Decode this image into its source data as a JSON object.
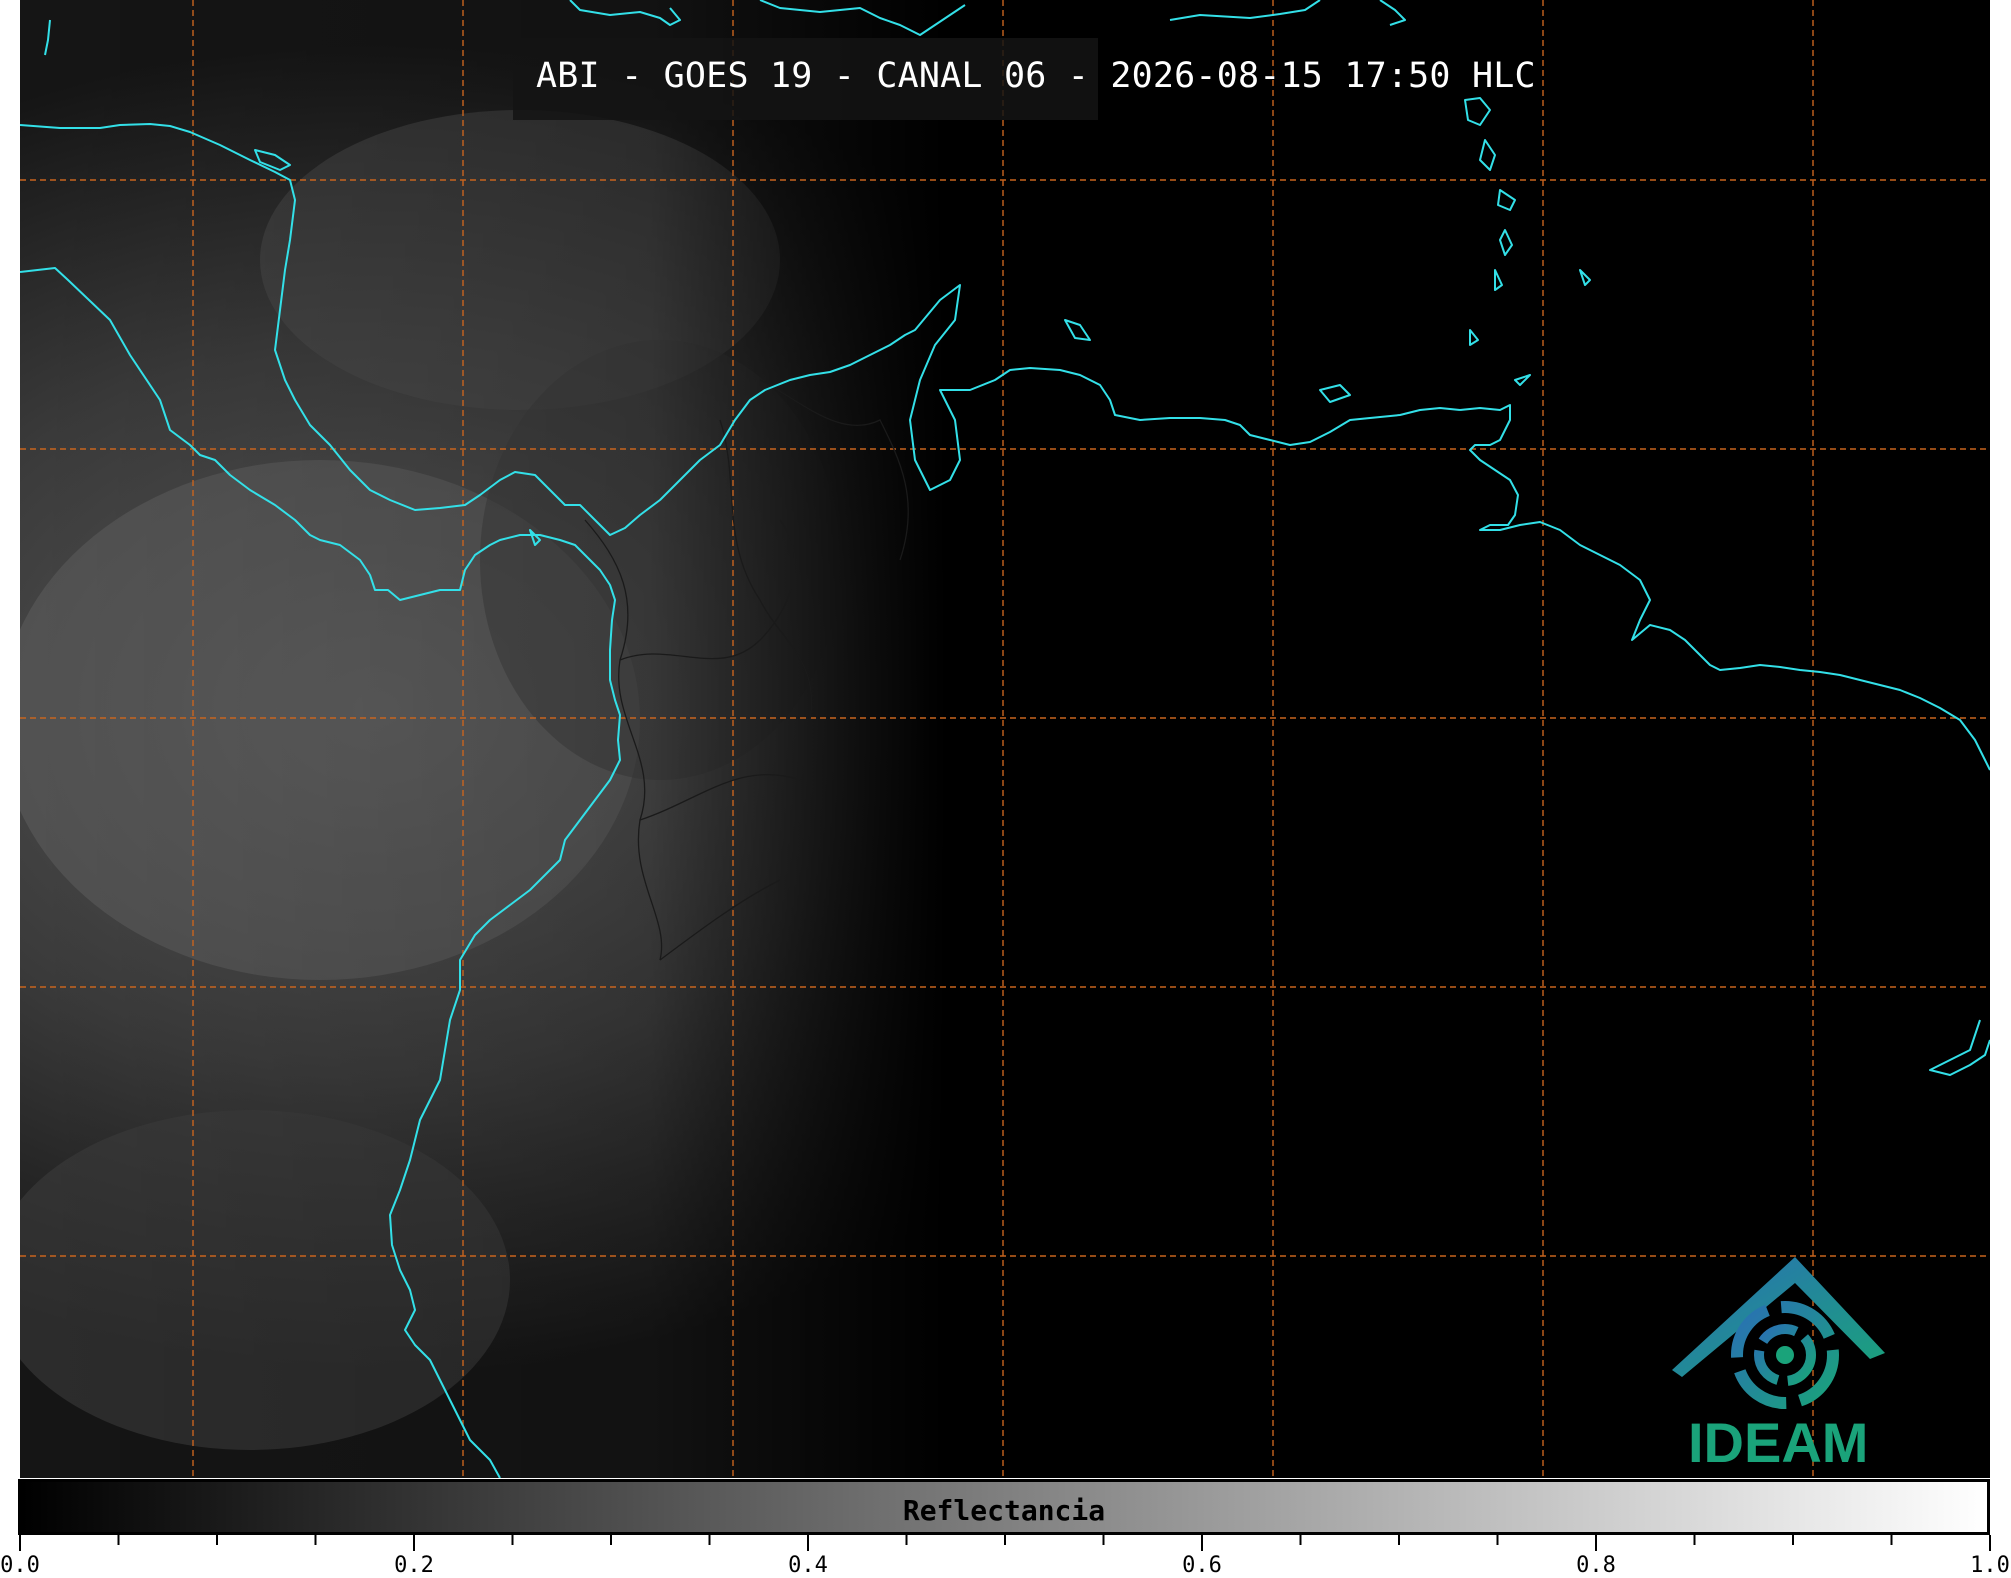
{
  "title": "ABI - GOES 19 - CANAL 06 - 2026-08-15 17:50 HLC",
  "colorbar": {
    "label": "Reflectancia",
    "min": 0.0,
    "max": 1.0,
    "tick_labels": [
      "0.0",
      "0.2",
      "0.4",
      "0.6",
      "0.8",
      "1.0"
    ],
    "colormap": "grayscale"
  },
  "logo": {
    "text": "IDEAM",
    "color_blue": "#2a6fb5",
    "color_green": "#1aa37a"
  },
  "colors": {
    "coastline": "#33e0e8",
    "gridline": "#c8641e",
    "background": "#000000"
  }
}
